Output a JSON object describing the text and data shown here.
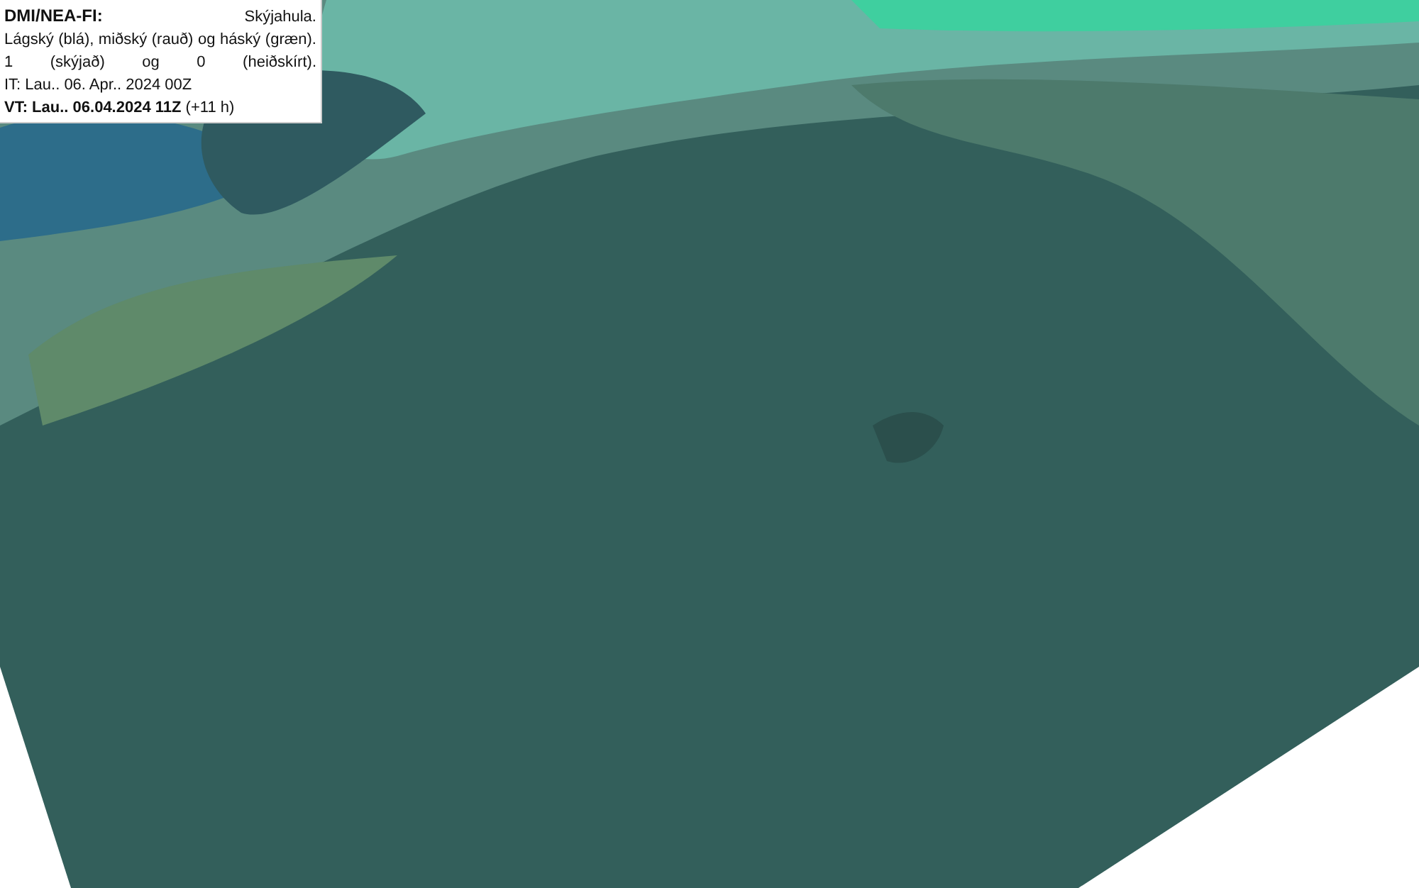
{
  "legend": {
    "source": "DMI/NEA-FI:",
    "parameter": "Skýjahula.",
    "description": "Lágský (blá), miðský (rauð) og háský (græn). 1 (skýjað) og 0 (heiðskírt).",
    "initial_time": "IT: Lau.. 06. Apr.. 2024 00Z",
    "valid_time": "**VT: Lau.. 06.04.2024 11Z** (+11 h)"
  }
}
